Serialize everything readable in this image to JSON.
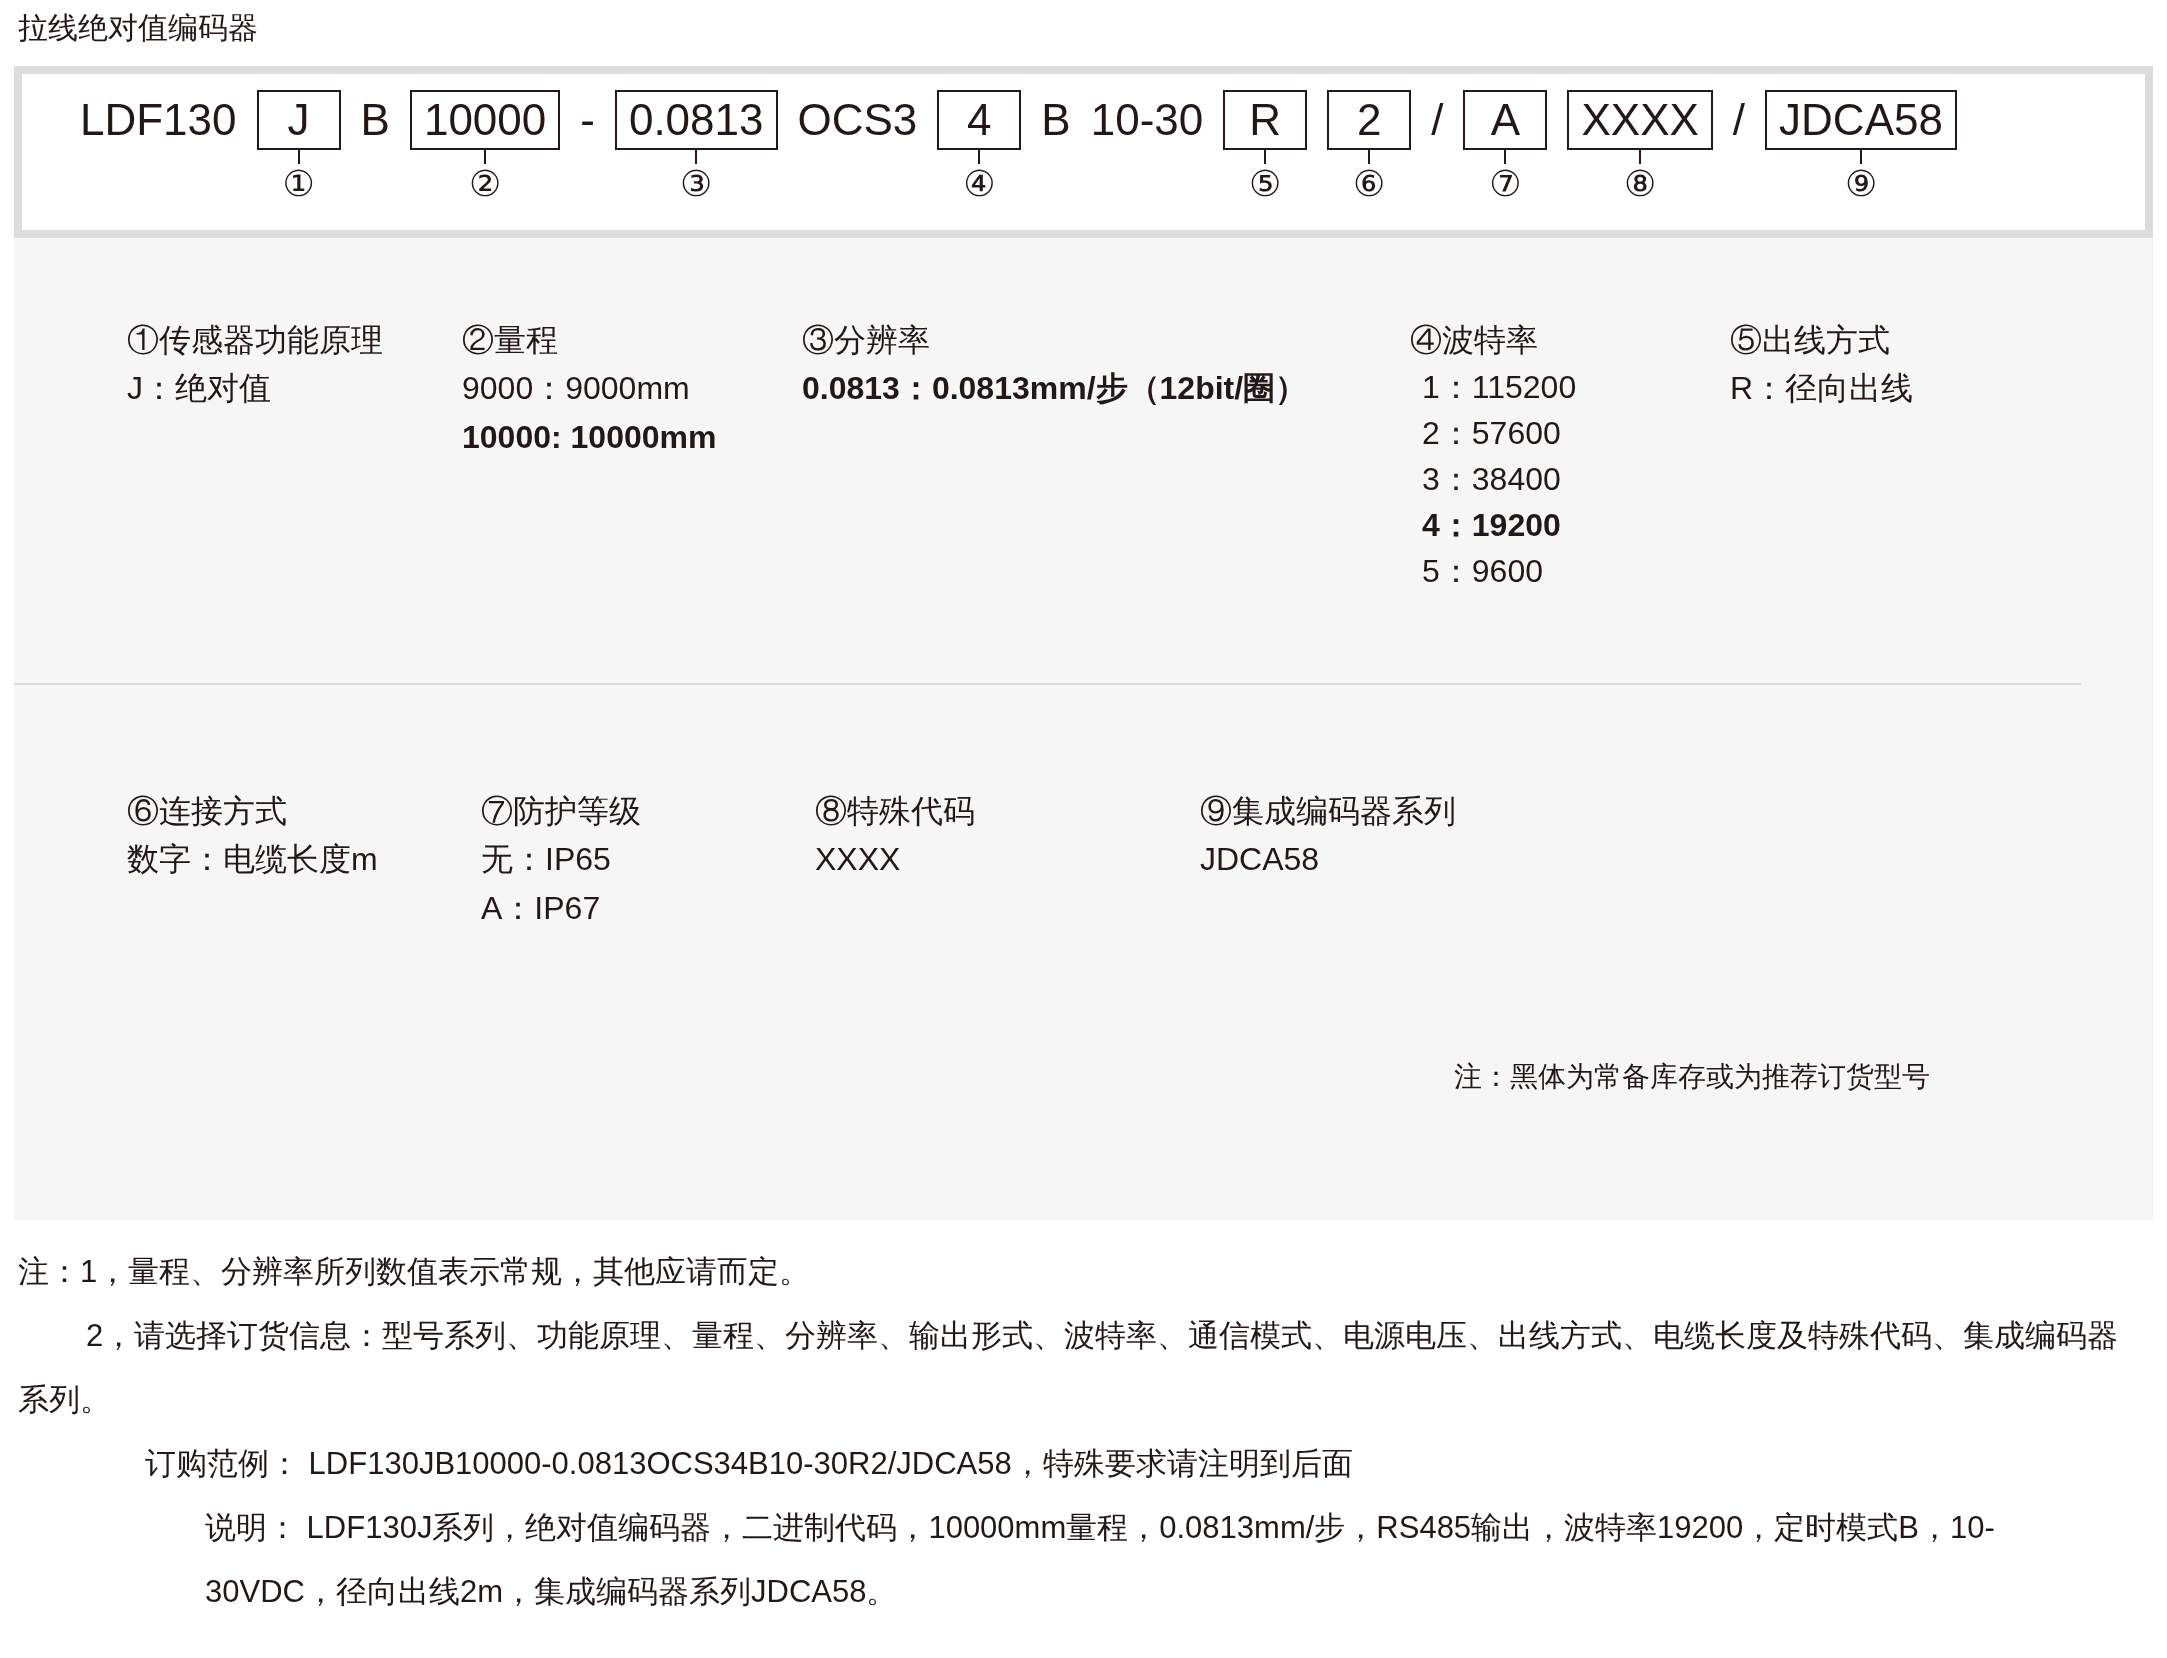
{
  "title": "拉线绝对值编码器",
  "code": [
    {
      "kind": "plain",
      "text": "LDF130"
    },
    {
      "kind": "boxed",
      "text": "J",
      "marker": "①"
    },
    {
      "kind": "plain",
      "text": "B"
    },
    {
      "kind": "boxed",
      "text": "10000",
      "marker": "②"
    },
    {
      "kind": "plain",
      "text": "-"
    },
    {
      "kind": "boxed",
      "text": "0.0813",
      "marker": "③"
    },
    {
      "kind": "plain",
      "text": "OCS3"
    },
    {
      "kind": "boxed",
      "text": "4",
      "marker": "④"
    },
    {
      "kind": "plain",
      "text": "B"
    },
    {
      "kind": "plain",
      "text": "10-30"
    },
    {
      "kind": "boxed",
      "text": "R",
      "marker": "⑤"
    },
    {
      "kind": "boxed",
      "text": "2",
      "marker": "⑥"
    },
    {
      "kind": "plain",
      "text": "/"
    },
    {
      "kind": "boxed",
      "text": "A",
      "marker": "⑦"
    },
    {
      "kind": "boxed",
      "text": "XXXX",
      "marker": "⑧"
    },
    {
      "kind": "plain",
      "text": "/"
    },
    {
      "kind": "boxed",
      "text": "JDCA58",
      "marker": "⑨"
    }
  ],
  "groups": [
    {
      "columns": [
        {
          "heading": "①传感器功能原理",
          "options": [
            {
              "text": "J：绝对值",
              "recommended": false
            }
          ]
        },
        {
          "heading": "②量程",
          "options": [
            {
              "text": "9000：9000mm",
              "recommended": false
            },
            {
              "text": "10000: 10000mm",
              "recommended": true
            }
          ]
        },
        {
          "heading": "③分辨率",
          "options": [
            {
              "text": "0.0813：0.0813mm/步（12bit/圈）",
              "recommended": true
            }
          ]
        },
        {
          "heading": "④波特率",
          "options": [
            {
              "text": "1：115200",
              "recommended": false
            },
            {
              "text": "2：57600",
              "recommended": false
            },
            {
              "text": "3：38400",
              "recommended": false
            },
            {
              "text": "4：19200",
              "recommended": true
            },
            {
              "text": "5：9600",
              "recommended": false
            }
          ]
        },
        {
          "heading": "⑤出线方式",
          "options": [
            {
              "text": "R：径向出线",
              "recommended": false
            }
          ]
        }
      ]
    },
    {
      "columns": [
        {
          "heading": "⑥连接方式",
          "options": [
            {
              "text": "数字：电缆长度m",
              "recommended": false
            }
          ]
        },
        {
          "heading": "⑦防护等级",
          "options": [
            {
              "text": "无：IP65",
              "recommended": false
            },
            {
              "text": "A：IP67",
              "recommended": false
            }
          ]
        },
        {
          "heading": "⑧特殊代码",
          "options": [
            {
              "text": "XXXX",
              "recommended": false
            }
          ]
        },
        {
          "heading": "⑨集成编码器系列",
          "options": [
            {
              "text": "JDCA58",
              "recommended": false
            }
          ]
        }
      ]
    }
  ],
  "panel_note": "注：黑体为常备库存或为推荐订货型号",
  "notes": [
    {
      "kind": "first",
      "text": "注：1，量程、分辨率所列数值表示常规，其他应请而定。"
    },
    {
      "kind": "indent",
      "text": "2，请选择订货信息：型号系列、功能原理、量程、分辨率、输出形式、波特率、通信模式、电源电压、出线方式、电缆长度及特殊代码、集成编码器系列。"
    },
    {
      "kind": "example",
      "text": "订购范例：  LDF130JB10000-0.0813OCS34B10-30R2/JDCA58，特殊要求请注明到后面"
    },
    {
      "kind": "explain",
      "text": "说明：  LDF130J系列，绝对值编码器，二进制代码，10000mm量程，0.0813mm/步，RS485输出，波特率19200，定时模式B，10-30VDC，径向出线2m，集成编码器系列JDCA58。"
    }
  ]
}
